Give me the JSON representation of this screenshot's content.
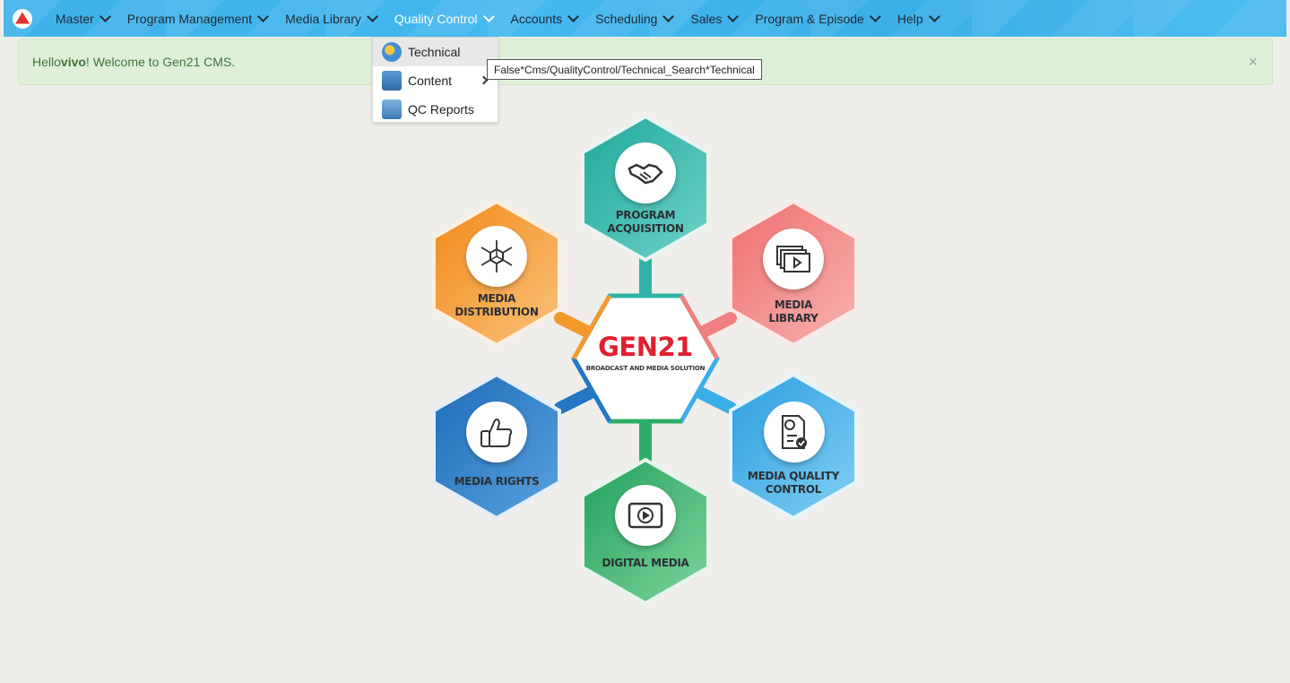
{
  "nav": {
    "items": [
      {
        "label": "Master"
      },
      {
        "label": "Program Management"
      },
      {
        "label": "Media Library"
      },
      {
        "label": "Quality Control",
        "active": true
      },
      {
        "label": "Accounts"
      },
      {
        "label": "Scheduling"
      },
      {
        "label": "Sales"
      },
      {
        "label": "Program & Episode"
      },
      {
        "label": "Help"
      }
    ]
  },
  "alert": {
    "hello": "Hello ",
    "user": "vivo",
    "message": "! Welcome to Gen21 CMS.",
    "close": "×"
  },
  "dropdown": {
    "items": [
      {
        "label": "Technical",
        "icon": "gear-icon"
      },
      {
        "label": "Content",
        "icon": "book-icon",
        "has_submenu": true
      },
      {
        "label": "QC Reports",
        "icon": "report-icon"
      }
    ]
  },
  "tooltip": {
    "text": "False*Cms/QualityControl/Technical_Search*Technical"
  },
  "graphic": {
    "center_title": "GEN21",
    "center_subtitle": "BROADCAST AND MEDIA SOLUTION",
    "modules": [
      {
        "line1": "PROGRAM",
        "line2": "ACQUISITION",
        "color": "#2fb3a6",
        "icon": "handshake-icon"
      },
      {
        "line1": "MEDIA",
        "line2": "LIBRARY",
        "color": "#f07f7f",
        "icon": "media-library-icon"
      },
      {
        "line1": "MEDIA QUALITY",
        "line2": "CONTROL",
        "color": "#3aaee6",
        "icon": "quality-report-icon"
      },
      {
        "line1": "DIGITAL MEDIA",
        "line2": "",
        "color": "#2ead68",
        "icon": "play-icon"
      },
      {
        "line1": "MEDIA RIGHTS",
        "line2": "",
        "color": "#2477c2",
        "icon": "thumbs-up-icon"
      },
      {
        "line1": "MEDIA",
        "line2": "DISTRIBUTION",
        "color": "#f39a2d",
        "icon": "distribution-icon"
      }
    ]
  }
}
